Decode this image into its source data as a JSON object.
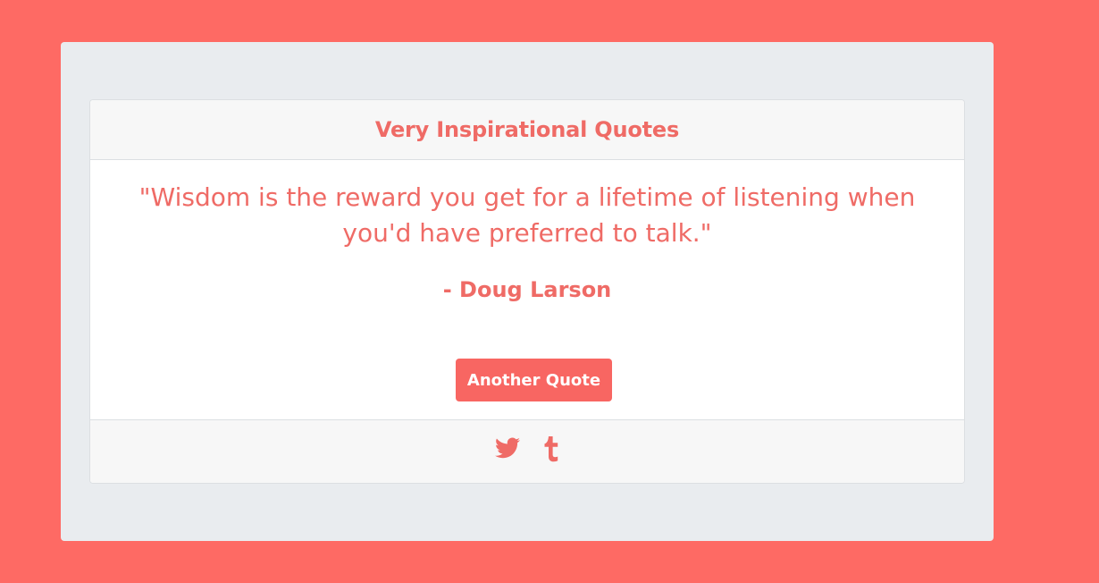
{
  "card": {
    "title": "Very Inspirational Quotes"
  },
  "quote": {
    "text": "\"Wisdom is the reward you get for a lifetime of listening when you'd have preferred to talk.\"",
    "author": "- Doug Larson"
  },
  "actions": {
    "new_quote_label": "Another Quote"
  },
  "share": [
    {
      "icon": "twitter-icon"
    },
    {
      "icon": "tumblr-icon"
    }
  ],
  "colors": {
    "background": "#fe6a64",
    "accent": "#ef6b66",
    "button": "#f86662",
    "panel": "#e9ecef"
  }
}
